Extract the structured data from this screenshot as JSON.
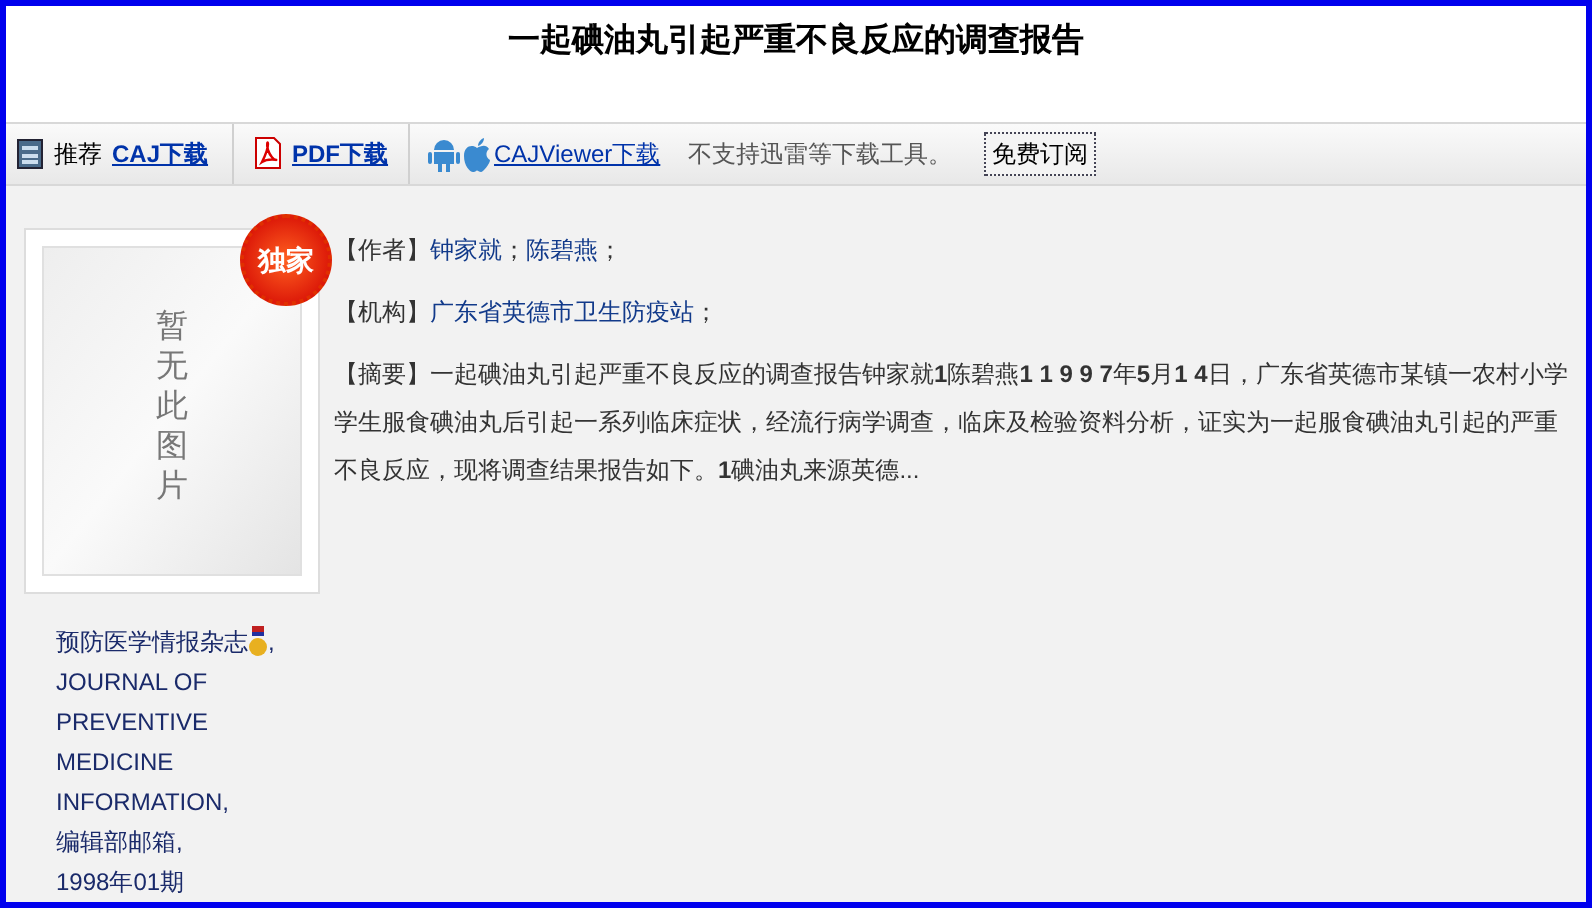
{
  "title": "一起碘油丸引起严重不良反应的调查报告",
  "toolbar": {
    "recommend_label": "推荐",
    "caj_link": "CAJ下载",
    "pdf_link": "PDF下载",
    "viewer_link": "CAJViewer下载",
    "notice": "不支持迅雷等下载工具。",
    "subscribe_button": "免费订阅"
  },
  "cover": {
    "placeholder_text": "暂无此图片",
    "badge": "独家"
  },
  "journal": {
    "name": "预防医学情报杂志",
    "separator": ",",
    "lines": [
      "JOURNAL OF PREVENTIVE MEDICINE INFORMATION,",
      "编辑部邮箱,",
      "1998年01期"
    ]
  },
  "fields": [
    {
      "label": "【作者】",
      "links": [
        "钟家就",
        "陈碧燕"
      ],
      "sep": "；"
    },
    {
      "label": "【机构】",
      "links": [
        "广东省英德市卫生防疫站"
      ],
      "sep": "；"
    }
  ],
  "abstract": {
    "label": "【摘要】",
    "text": "一起碘油丸引起严重不良反应的调查报告钟家就**1**陈碧燕**1 1 9 9 7**年**5**月**1 4**日，广东省英德市某镇一农村小学学生服食碘油丸后引起一系列临床症状，经流行病学调查，临床及检验资料分析，证实为一起服食碘油丸引起的严重不良反应，现将调查结果报告如下。**1**碘油丸来源英德..."
  }
}
